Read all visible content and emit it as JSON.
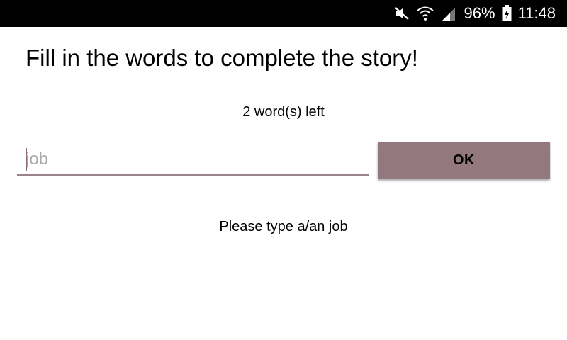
{
  "status_bar": {
    "battery": "96%",
    "time": "11:48",
    "icons": [
      "mute-icon",
      "wifi-icon",
      "signal-icon",
      "battery-icon"
    ]
  },
  "title": "Fill in the words to complete the story!",
  "words_left": "2 word(s) left",
  "input": {
    "value": "",
    "placeholder": "job"
  },
  "ok_button": {
    "label": "OK"
  },
  "prompt": "Please type a/an job",
  "colors": {
    "accent": "#93787d",
    "underline": "#9c8289",
    "status_bar_bg": "#000000",
    "background": "#ffffff"
  }
}
